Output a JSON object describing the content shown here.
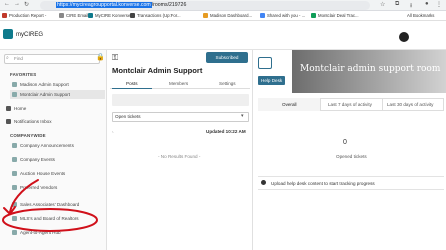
{
  "browser": {
    "url_selected": "https://mycireagroupportal.konverse.com",
    "url_rest": "/rooms/219726",
    "bookmarks": [
      {
        "label": "Production Report -"
      },
      {
        "label": "CIRE Email"
      },
      {
        "label": "MyCIRE Konverse"
      },
      {
        "label": "Transactions (Up:For..."
      },
      {
        "label": "Madison Dashboard..."
      },
      {
        "label": "Shared with you - ..."
      },
      {
        "label": "Montclair Deal Trac..."
      }
    ],
    "all_bookmarks": "All Bookmarks"
  },
  "app": {
    "logo_text": "myCIREG"
  },
  "sidebar": {
    "find_placeholder": "Find",
    "favorites_label": "FAVORITES",
    "companywide_label": "COMPANYWIDE",
    "favorites": [
      {
        "label": "Madison Admin Support"
      },
      {
        "label": "Montclair Admin Support"
      }
    ],
    "home": "Home",
    "inbox": "Notifications Inbox",
    "companywide": [
      {
        "label": "Company Announcements"
      },
      {
        "label": "Company Events"
      },
      {
        "label": "Auction House Events"
      },
      {
        "label": "Preferred Vendors"
      },
      {
        "label": "Sales Associates' Dashboard"
      },
      {
        "label": "MLS's and Board of Realtors"
      },
      {
        "label": "Agent-to-Agent Hub"
      }
    ]
  },
  "room": {
    "title": "Montclair Admin Support",
    "subscribed_label": "Subscribed",
    "tabs": [
      {
        "label": "Posts"
      },
      {
        "label": "Members"
      },
      {
        "label": "Settings"
      }
    ],
    "filter_value": "Open tickets",
    "updated": "Updated 10:22 AM",
    "no_results": "- No Results Found -"
  },
  "helpdesk": {
    "banner_title": "Montclair admin support room",
    "label": "Help Desk",
    "tabs": [
      {
        "label": "Overall"
      },
      {
        "label": "Last 7 days of activity"
      },
      {
        "label": "Last 30 days of activity"
      }
    ],
    "opened_count": "0",
    "opened_label": "Opened tickets",
    "upload_text": "Upload help desk content to start tracking progress"
  },
  "colors": {
    "accent": "#2f6f8e",
    "annotation": "#d0101a"
  }
}
